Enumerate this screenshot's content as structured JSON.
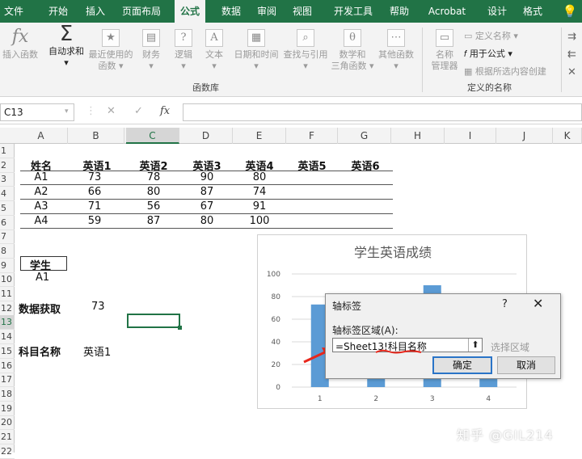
{
  "tabs": [
    "文件",
    "开始",
    "插入",
    "页面布局",
    "公式",
    "数据",
    "审阅",
    "视图",
    "开发工具",
    "帮助",
    "Acrobat",
    "设计",
    "格式"
  ],
  "active_tab": "公式",
  "ribbon": {
    "insert_function": "插入函数",
    "autosum_l1": "自动求和",
    "recent_l1": "最近使用的",
    "recent_l2": "函数",
    "finance": "财务",
    "logic": "逻辑",
    "text": "文本",
    "datetime": "日期和时间",
    "lookup": "查找与引用",
    "math_l1": "数学和",
    "math_l2": "三角函数",
    "other": "其他函数",
    "group_library": "函数库",
    "name_mgr_l1": "名称",
    "name_mgr_l2": "管理器",
    "define_name": "定义名称",
    "use_in_formula": "用于公式",
    "create_from_sel": "根据所选内容创建",
    "group_names": "定义的名称"
  },
  "formula_bar": {
    "name_box": "C13",
    "cancel": "✕",
    "enter": "✓",
    "fx": "fx",
    "content": ""
  },
  "columns": [
    "A",
    "B",
    "C",
    "D",
    "E",
    "F",
    "G",
    "H",
    "I",
    "J",
    "K"
  ],
  "rows": [
    "1",
    "2",
    "3",
    "4",
    "5",
    "6",
    "7",
    "8",
    "9",
    "10",
    "11",
    "12",
    "13",
    "14",
    "15",
    "16",
    "17",
    "18",
    "19",
    "20",
    "21",
    "22"
  ],
  "selected_column": "C",
  "selected_row": "13",
  "table": {
    "headers": [
      "姓名",
      "英语1",
      "英语2",
      "英语3",
      "英语4",
      "英语5",
      "英语6"
    ],
    "data": [
      [
        "A1",
        "73",
        "78",
        "90",
        "80"
      ],
      [
        "A2",
        "66",
        "80",
        "87",
        "74"
      ],
      [
        "A3",
        "71",
        "56",
        "67",
        "91"
      ],
      [
        "A4",
        "59",
        "87",
        "80",
        "100"
      ]
    ]
  },
  "student_label": "学生",
  "student_value": "A1",
  "fetch_label": "数据获取",
  "fetch_value": "73",
  "subject_label": "科目名称",
  "subject_value": "英语1",
  "chart_data": {
    "type": "bar",
    "title": "学生英语成绩",
    "categories": [
      "1",
      "2",
      "3",
      "4"
    ],
    "values": [
      73,
      66,
      90,
      78
    ],
    "ylim": [
      0,
      100
    ],
    "yticks": [
      "0",
      "20",
      "40",
      "60",
      "80",
      "100"
    ],
    "color": "#5b9bd5",
    "grid": true
  },
  "dialog": {
    "title": "轴标签",
    "help": "?",
    "close": "✕",
    "field_label": "轴标签区域(A):",
    "field_value": "=Sheet13!科目名称",
    "picker": "⬆",
    "hint": "选择区域",
    "ok": "确定",
    "cancel": "取消"
  },
  "watermark": "知乎 @GIL214"
}
